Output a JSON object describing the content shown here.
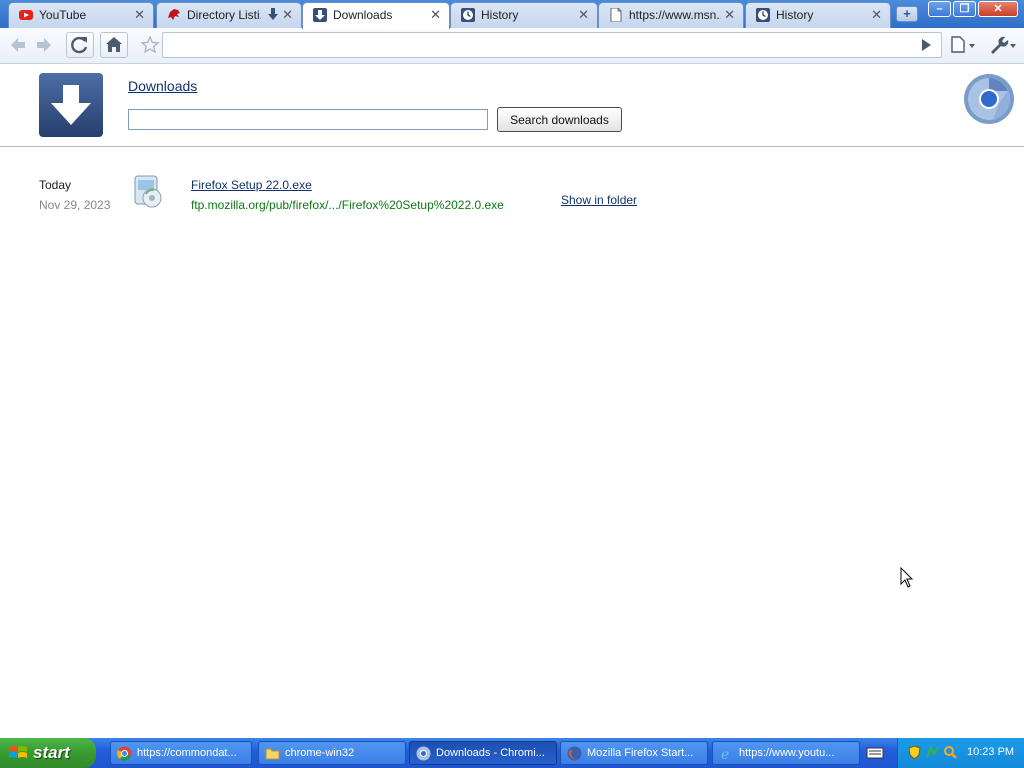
{
  "browser": {
    "tabs": [
      {
        "title": "YouTube",
        "icon": "youtube-icon"
      },
      {
        "title": "Directory Listi...",
        "icon": "mozilla-dino-icon"
      },
      {
        "title": "Downloads",
        "icon": "download-icon",
        "active": true
      },
      {
        "title": "History",
        "icon": "clock-icon"
      },
      {
        "title": "https://www.msn...",
        "icon": "page-icon"
      },
      {
        "title": "History",
        "icon": "clock-icon"
      }
    ],
    "close_glyph": "✕",
    "new_tab_glyph": "+",
    "window_buttons": {
      "minimize": "–",
      "restore": "❐",
      "close": "✕"
    },
    "omnibox_value": ""
  },
  "downloads_page": {
    "heading": "Downloads",
    "search_placeholder": "",
    "search_button": "Search downloads",
    "items": [
      {
        "date_label": "Today",
        "date": "Nov 29, 2023",
        "file_name": "Firefox Setup 22.0.exe",
        "url": "ftp.mozilla.org/pub/firefox/.../Firefox%20Setup%2022.0.exe",
        "action": "Show in folder"
      }
    ]
  },
  "taskbar": {
    "start_label": "start",
    "tasks": [
      {
        "label": "https://commondat...",
        "icon": "chrome-icon"
      },
      {
        "label": "chrome-win32",
        "icon": "folder-icon"
      },
      {
        "label": "Downloads - Chromi...",
        "icon": "chromium-icon",
        "active": true
      },
      {
        "label": "Mozilla Firefox Start...",
        "icon": "firefox-icon"
      },
      {
        "label": "https://www.youtu...",
        "icon": "ie-icon"
      }
    ],
    "clock": "10:23 PM"
  },
  "colors": {
    "link": "#11336b",
    "url_green": "#0a7a14",
    "taskbar_blue": "#245edb",
    "start_green": "#379b2f"
  }
}
